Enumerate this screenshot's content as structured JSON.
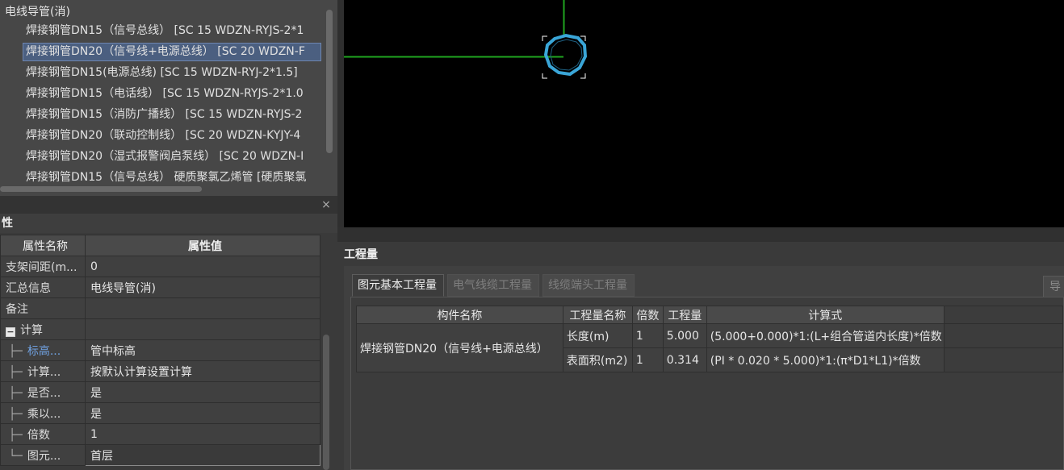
{
  "tree": {
    "root_label": "电线导管(消)",
    "items": [
      {
        "label": "焊接钢管DN15（信号总线）  [SC 15 WDZN-RYJS-2*1",
        "selected": false
      },
      {
        "label": "焊接钢管DN20（信号线+电源总线）  [SC 20 WDZN-F",
        "selected": true
      },
      {
        "label": "焊接钢管DN15(电源总线) [SC 15 WDZN-RYJ-2*1.5]",
        "selected": false
      },
      {
        "label": "焊接钢管DN15（电话线）  [SC 15 WDZN-RYJS-2*1.0",
        "selected": false
      },
      {
        "label": "焊接钢管DN15（消防广播线）  [SC 15 WDZN-RYJS-2",
        "selected": false
      },
      {
        "label": "焊接钢管DN20（联动控制线）  [SC 20 WDZN-KYJY-4",
        "selected": false
      },
      {
        "label": "焊接钢管DN20（湿式报警阀启泵线）  [SC 20 WDZN-I",
        "selected": false
      },
      {
        "label": "焊接钢管DN15（信号总线）  硬质聚氯乙烯管 [硬质聚氯",
        "selected": false
      }
    ]
  },
  "close_label": "×",
  "properties": {
    "title": "性",
    "header_name": "属性名称",
    "header_value": "属性值",
    "rows": [
      {
        "name": "支架间距(m...",
        "value": "0"
      },
      {
        "name": "汇总信息",
        "value": "电线导管(消)"
      },
      {
        "name": "备注",
        "value": ""
      },
      {
        "name": "计算",
        "value": "",
        "group": true
      },
      {
        "name": "标高...",
        "value": "管中标高",
        "child": true,
        "link": true
      },
      {
        "name": "计算...",
        "value": "按默认计算设置计算",
        "child": true
      },
      {
        "name": "是否...",
        "value": "是",
        "child": true
      },
      {
        "name": "乘以...",
        "value": "是",
        "child": true
      },
      {
        "name": "倍数",
        "value": "1",
        "child": true
      },
      {
        "name": "图元...",
        "value": "首层",
        "child": true,
        "last": true,
        "editing": true
      }
    ],
    "group_expander": "−"
  },
  "quantity": {
    "title": "工程量",
    "tabs": [
      {
        "label": "图元基本工程量",
        "active": true
      },
      {
        "label": "电气线缆工程量",
        "active": false
      },
      {
        "label": "线缆端头工程量",
        "active": false
      }
    ],
    "export_label": "导",
    "headers": [
      "构件名称",
      "工程量名称",
      "倍数",
      "工程量",
      "计算式"
    ],
    "component_name": "焊接钢管DN20（信号线+电源总线）",
    "rows": [
      {
        "qty_name": "长度(m)",
        "multiplier": "1",
        "amount": "5.000",
        "formula": "(5.000+0.000)*1:(L+组合管道内长度)*倍数"
      },
      {
        "qty_name": "表面积(m2)",
        "multiplier": "1",
        "amount": "0.314",
        "formula": "(PI * 0.020 * 5.000)*1:(π*D1*L1)*倍数"
      }
    ]
  },
  "colors": {
    "pipe_line": "#1fa51f",
    "pipe_section": "#3aa6d8",
    "canvas_bg": "#000000",
    "selection_bg": "#4b5f80"
  }
}
